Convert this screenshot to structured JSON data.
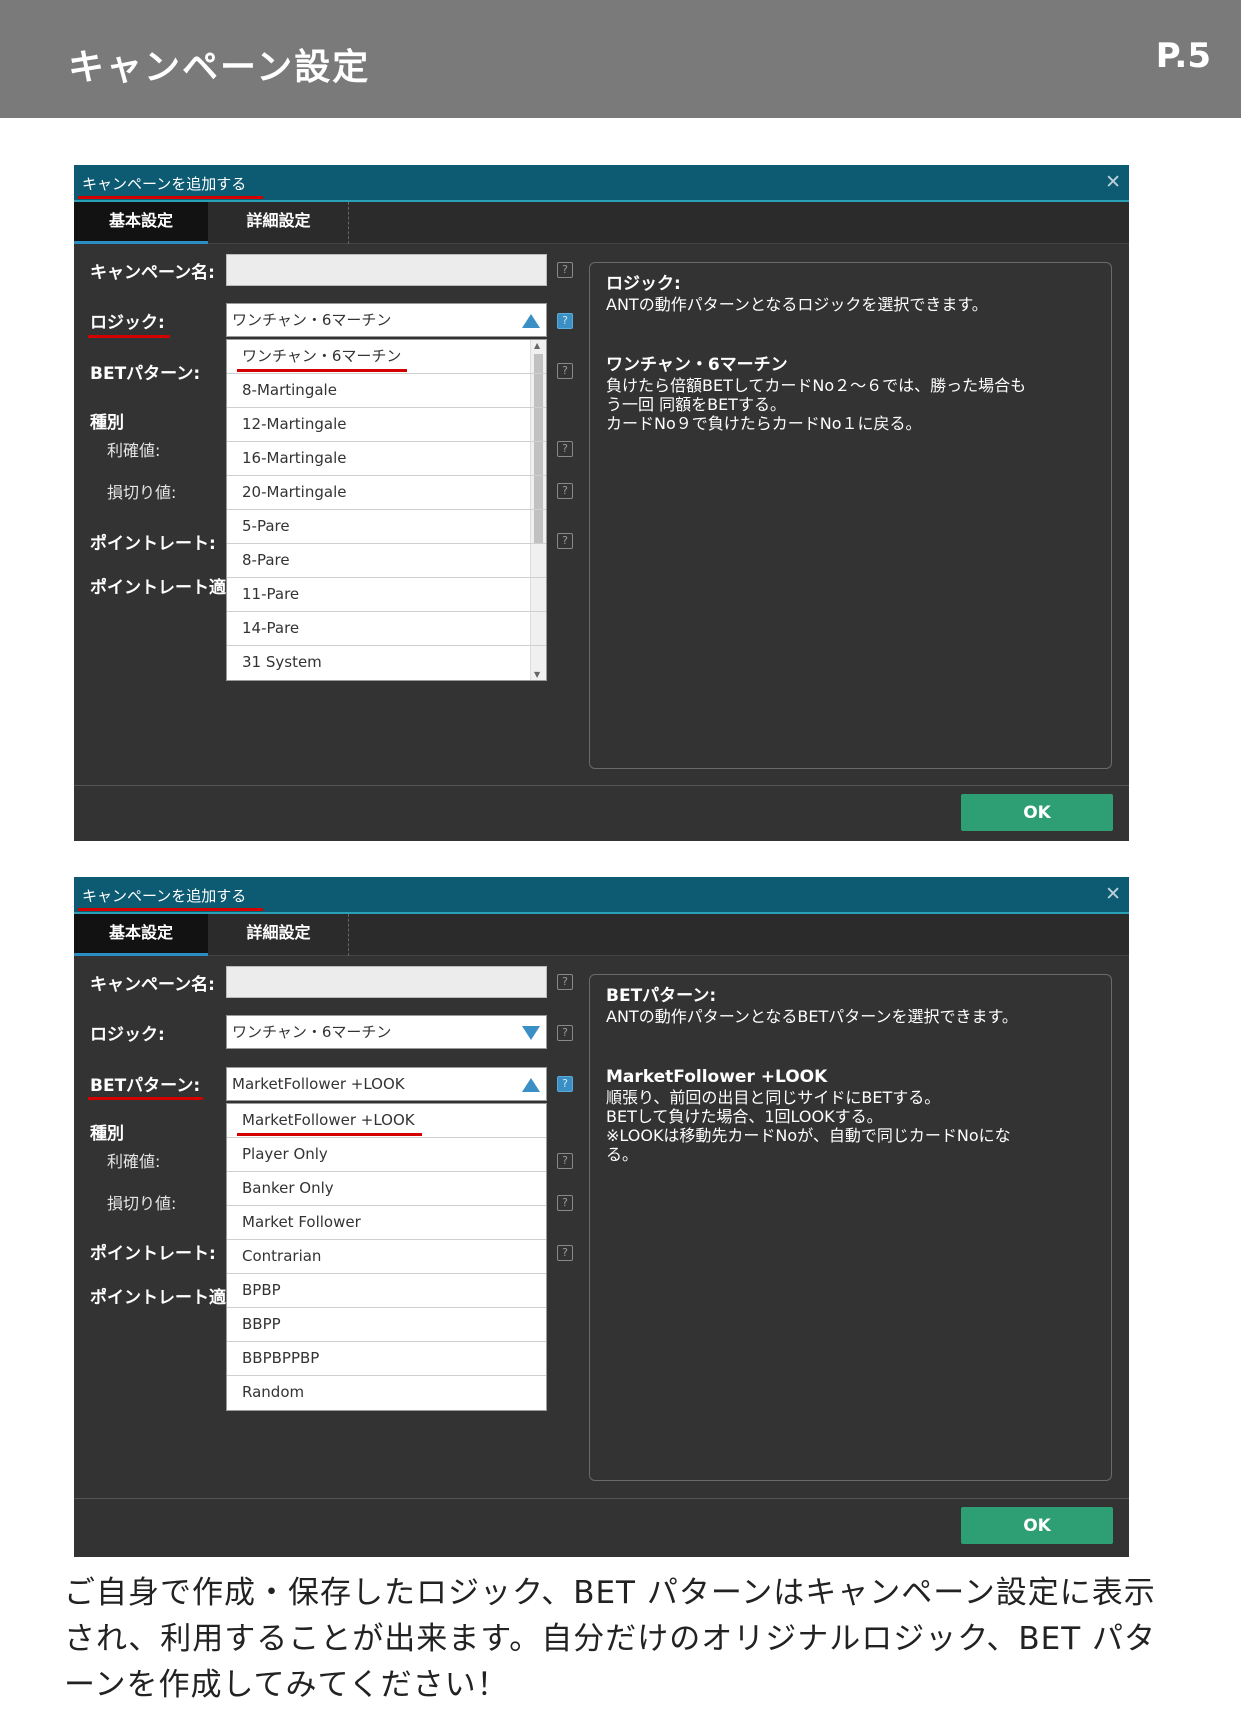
{
  "header": {
    "title": "キャンペーン設定",
    "page_number": "P.5"
  },
  "dialogs": [
    {
      "title": "キャンペーンを追加する",
      "tabs": [
        "基本設定",
        "詳細設定"
      ],
      "labels": {
        "campaign_name": "キャンペーン名:",
        "logic": "ロジック:",
        "bet_pattern": "BETパターン:",
        "type": "種別",
        "profit": "利確値:",
        "stop_loss": "損切り値:",
        "point_rate": "ポイントレート:",
        "point_rate_apply": "ポイントレート適"
      },
      "selected_value": "ワンチャン・6マーチン",
      "dropdown_items": [
        "ワンチャン・6マーチン",
        "8-Martingale",
        "12-Martingale",
        "16-Martingale",
        "20-Martingale",
        "5-Pare",
        "8-Pare",
        "11-Pare",
        "14-Pare",
        "31 System"
      ],
      "info": {
        "heading": "ロジック:",
        "text": "ANTの動作パターンとなるロジックを選択できます。",
        "heading2": "ワンチャン・6マーチン",
        "text2": "負けたら倍額BETしてカードNo２～６では、勝った場合も\nう一回 同額をBETする。\nカードNo９で負けたらカードNo１に戻る。"
      },
      "ok_label": "OK"
    },
    {
      "title": "キャンペーンを追加する",
      "tabs": [
        "基本設定",
        "詳細設定"
      ],
      "labels": {
        "campaign_name": "キャンペーン名:",
        "logic": "ロジック:",
        "bet_pattern": "BETパターン:",
        "type": "種別",
        "profit": "利確値:",
        "stop_loss": "損切り値:",
        "point_rate": "ポイントレート:",
        "point_rate_apply": "ポイントレート適"
      },
      "logic_value": "ワンチャン・6マーチン",
      "selected_value": "MarketFollower +LOOK",
      "dropdown_items": [
        "MarketFollower +LOOK",
        "Player Only",
        "Banker Only",
        "Market Follower",
        "Contrarian",
        "BPBP",
        "BBPP",
        "BBPBPPBP",
        "Random"
      ],
      "info": {
        "heading": "BETパターン:",
        "text": "ANTの動作パターンとなるBETパターンを選択できます。",
        "heading2": "MarketFollower +LOOK",
        "text2": "順張り、前回の出目と同じサイドにBETする。\nBETして負けた場合、1回LOOKする。\n※LOOKは移動先カードNoが、自動で同じカードNoにな\nる。"
      },
      "ok_label": "OK"
    }
  ],
  "help_icon": "?",
  "footnote": "ご自身で作成・保存したロジック、BET パターンはキャンペーン設定に表示され、利用することが出来ます。自分だけのオリジナルロジック、BET パターンを作成してみてください！",
  "colors": {
    "titlebar": "#0d5a73",
    "dialog_bg": "#333333",
    "ok": "#2e9e74",
    "accent": "#3a8fc4",
    "highlight": "#d40000"
  }
}
